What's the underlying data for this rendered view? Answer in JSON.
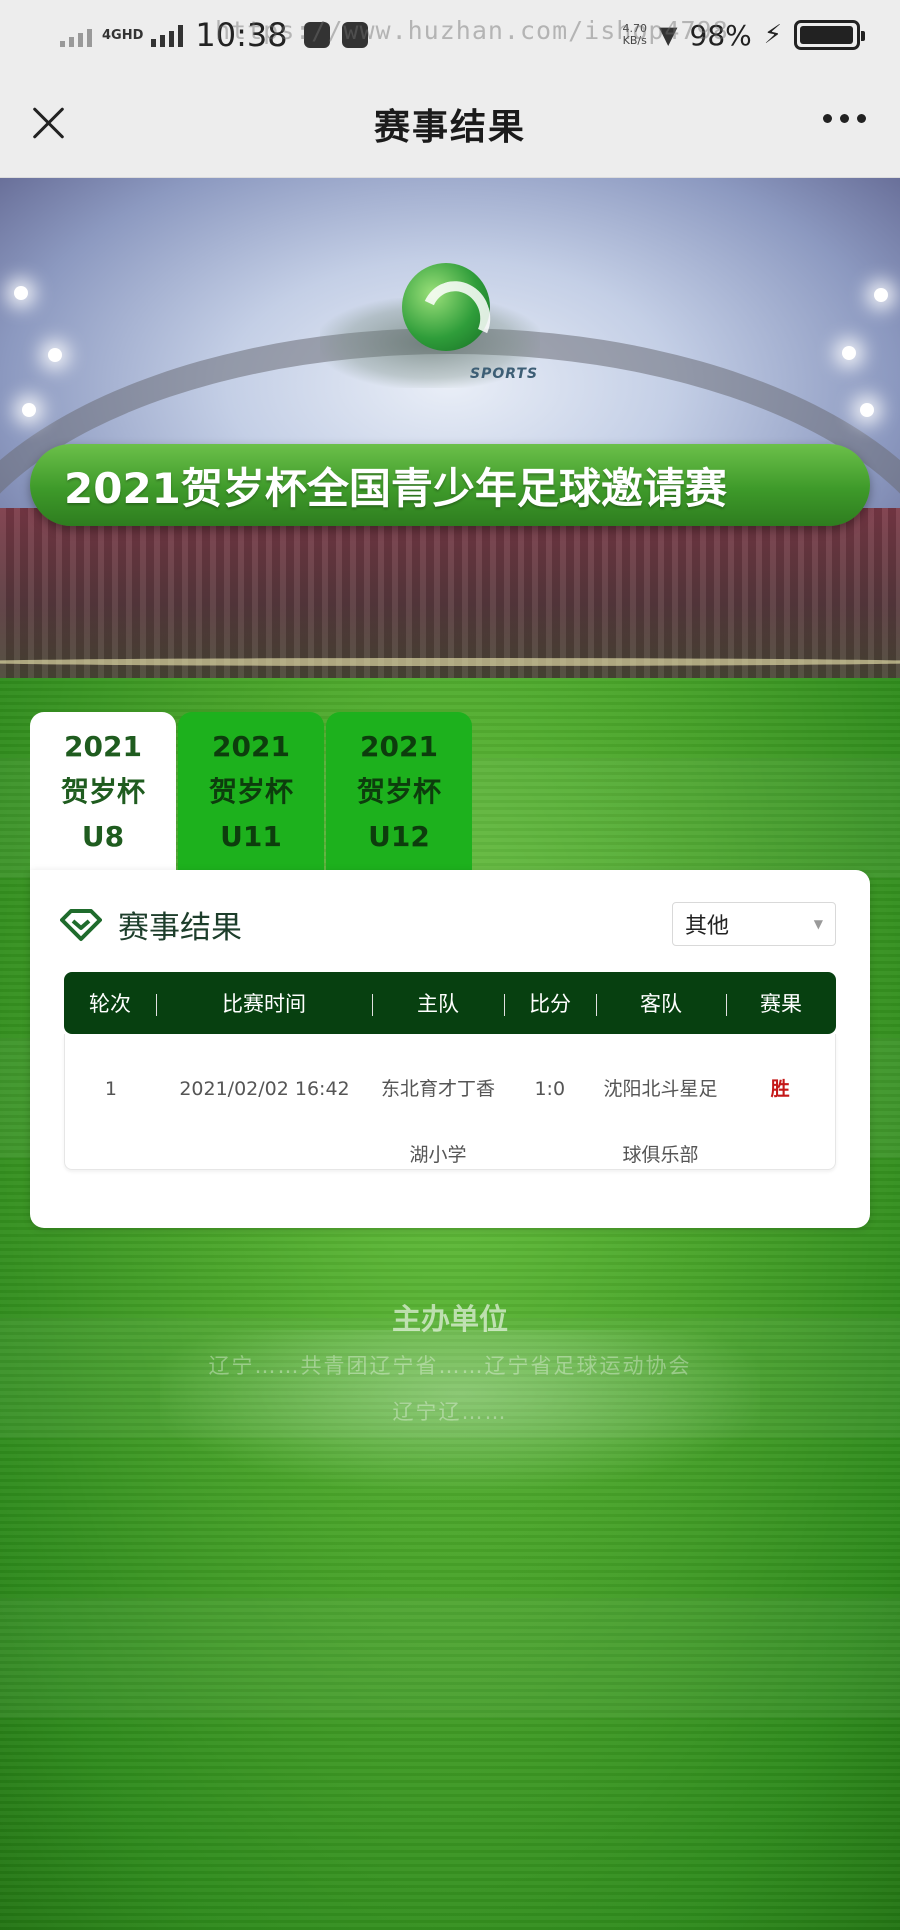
{
  "status_bar": {
    "network": "4GHD",
    "time": "10:38",
    "watermark_url": "https://www.huzhan.com/ishop4798",
    "speed_value": "4.70",
    "speed_unit": "KB/s",
    "battery_percent": "98%",
    "battery_level": 0.98
  },
  "nav": {
    "title": "赛事结果"
  },
  "hero": {
    "logo_text": "SPORTS",
    "banner_title": "2021贺岁杯全国青少年足球邀请赛"
  },
  "tabs": [
    {
      "year": "2021",
      "name": "贺岁杯",
      "group": "U8",
      "active": true
    },
    {
      "year": "2021",
      "name": "贺岁杯",
      "group": "U11",
      "active": false
    },
    {
      "year": "2021",
      "name": "贺岁杯",
      "group": "U12",
      "active": false
    }
  ],
  "results": {
    "title": "赛事结果",
    "filter_selected": "其他",
    "columns": [
      "轮次",
      "比赛时间",
      "主队",
      "比分",
      "客队",
      "赛果"
    ],
    "rows": [
      {
        "round": "1",
        "time": "2021/02/02 16:42",
        "home_line1": "东北育才丁香",
        "home_line2": "湖小学",
        "score": "1:0",
        "away_line1": "沈阳北斗星足",
        "away_line2": "球俱乐部",
        "result": "胜"
      }
    ]
  },
  "footer": {
    "sponsor_title": "主办单位",
    "sponsor_line1": "辽宁……共青团辽宁省……辽宁省足球运动协会",
    "sponsor_line2": "辽宁辽……"
  },
  "colors": {
    "tab_green": "#1db11d",
    "table_header": "#074010",
    "win_red": "#c41818"
  }
}
